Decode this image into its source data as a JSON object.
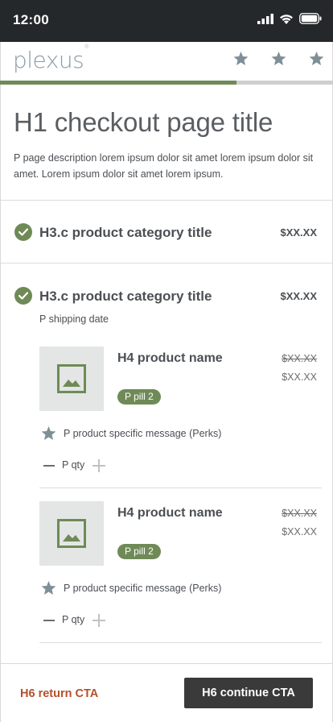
{
  "status_bar": {
    "time": "12:00"
  },
  "header": {
    "logo_text": "plexus",
    "logo_mark": "®",
    "step_icons": [
      "star-icon",
      "star-icon",
      "star-icon"
    ]
  },
  "progress": {
    "fraction": 0.71
  },
  "page": {
    "title": "H1 checkout page title",
    "description": "P page description lorem ipsum dolor sit amet lorem ipsum dolor sit amet. Lorem ipsum dolor sit amet lorem ipsum."
  },
  "categories": [
    {
      "title": "H3.c product category title",
      "price": "$XX.XX"
    },
    {
      "title": "H3.c product category title",
      "price": "$XX.XX",
      "shipping": "P shipping date"
    }
  ],
  "products": [
    {
      "name": "H4 product name",
      "price_old": "$XX.XX",
      "price_new": "$XX.XX",
      "pill": "P pill 2",
      "perk": "P product specific message (Perks)",
      "qty_label": "P qty"
    },
    {
      "name": "H4 product name",
      "price_old": "$XX.XX",
      "price_new": "$XX.XX",
      "pill": "P pill 2",
      "perk": "P product specific message (Perks)",
      "qty_label": "P qty"
    }
  ],
  "footer": {
    "return_label": "H6 return CTA",
    "continue_label": "H6 continue CTA"
  },
  "colors": {
    "accent": "#6f8a57",
    "return": "#b5502d",
    "dark": "#25282a"
  }
}
